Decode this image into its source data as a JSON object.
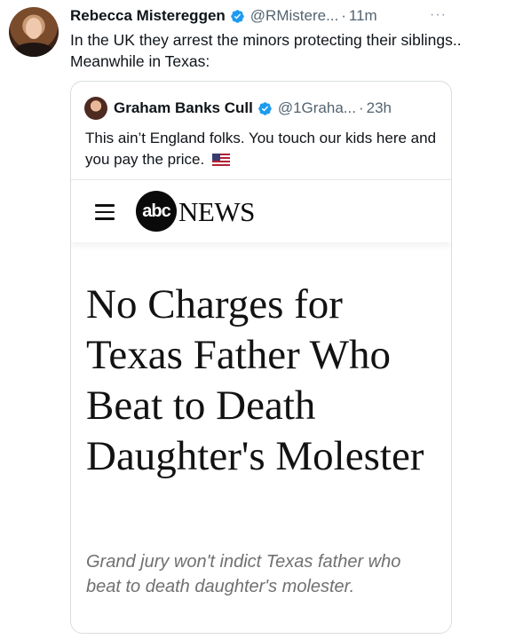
{
  "tweet": {
    "author_name": "Rebecca Mistereggen",
    "author_handle": "@RMistere...",
    "separator": "·",
    "time": "11m",
    "more": "···",
    "text": "In the UK they arrest the minors protecting their siblings.. Meanwhile in Texas:"
  },
  "quote": {
    "author_name": "Graham Banks Cull",
    "author_handle": "@1Graha...",
    "separator": "·",
    "time": "23h",
    "text": "This ain’t England folks. You touch our kids here and you pay the price."
  },
  "article": {
    "brand_logo_text": "abc",
    "brand_word": "NEWS",
    "headline": "No Charges for Texas Father Who Beat to Death Daughter's Molester",
    "subheadline": "Grand jury won't indict Texas father who beat to death daughter's molester."
  },
  "icons": {
    "verified": "verified-badge-icon",
    "menu": "hamburger-menu-icon",
    "flag": "us-flag-icon",
    "more": "more-options-icon"
  },
  "colors": {
    "verified_blue": "#1d9bf0",
    "text_primary": "#0f1419",
    "text_secondary": "#536471"
  }
}
